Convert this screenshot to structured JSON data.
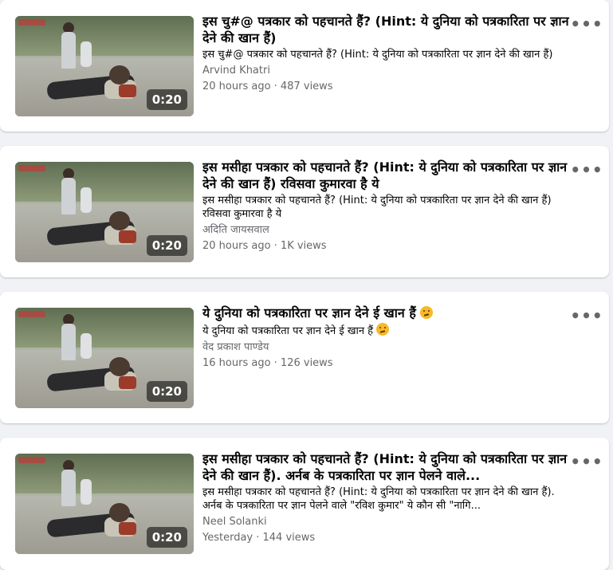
{
  "feed": {
    "items": [
      {
        "title": "इस चु#@ पत्रकार को पहचानते हैं? (Hint: ये दुनिया को पत्रकारिता पर ज्ञान देने की खान हैं)",
        "description": "इस चु#@ पत्रकार को पहचानते हैं? (Hint: ये दुनिया को पत्रकारिता पर ज्ञान देने की खान हैं)",
        "author": "Arvind Khatri",
        "time": "20 hours ago",
        "views": "487 views",
        "meta": "20 hours ago · 487 views",
        "duration": "0:20",
        "more_icon": "more-horizontal-icon",
        "emoji": false
      },
      {
        "title": "इस मसीहा पत्रकार को पहचानते हैं? (Hint: ये दुनिया को पत्रकारिता पर ज्ञान देने की खान हैं) रविसवा कुमारवा है ये",
        "description": "इस मसीहा पत्रकार को पहचानते हैं? (Hint: ये दुनिया को पत्रकारिता पर ज्ञान देने की खान हैं) रविसवा कुमारवा है ये",
        "author": "अदिति जायसवाल",
        "time": "20 hours ago",
        "views": "1K views",
        "meta": "20 hours ago · 1K views",
        "duration": "0:20",
        "more_icon": "more-horizontal-icon",
        "emoji": false
      },
      {
        "title": "ये दुनिया को पत्रकारिता पर ज्ञान देने ई खान हैं",
        "description": "ये दुनिया को पत्रकारिता पर ज्ञान देने ई खान हैं",
        "author": "वेद प्रकाश पाण्डेय",
        "time": "16 hours ago",
        "views": "126 views",
        "meta": "16 hours ago · 126 views",
        "duration": "0:20",
        "more_icon": "more-horizontal-icon",
        "emoji": true
      },
      {
        "title": "इस मसीहा पत्रकार को पहचानते हैं? (Hint: ये दुनिया को पत्रकारिता पर ज्ञान देने की खान हैं). अर्नब के पत्रकारिता पर ज्ञान पेलने वाले...",
        "description": "इस मसीहा पत्रकार को पहचानते हैं? (Hint: ये दुनिया को पत्रकारिता पर ज्ञान देने की खान हैं). अर्नब के पत्रकारिता पर ज्ञान पेलने वाले \"रविश कुमार\" ये कौन सी \"नागि...",
        "author": "Neel Solanki",
        "time": "Yesterday",
        "views": "144 views",
        "meta": "Yesterday · 144 views",
        "duration": "0:20",
        "more_icon": "more-horizontal-icon",
        "emoji": false
      }
    ]
  }
}
